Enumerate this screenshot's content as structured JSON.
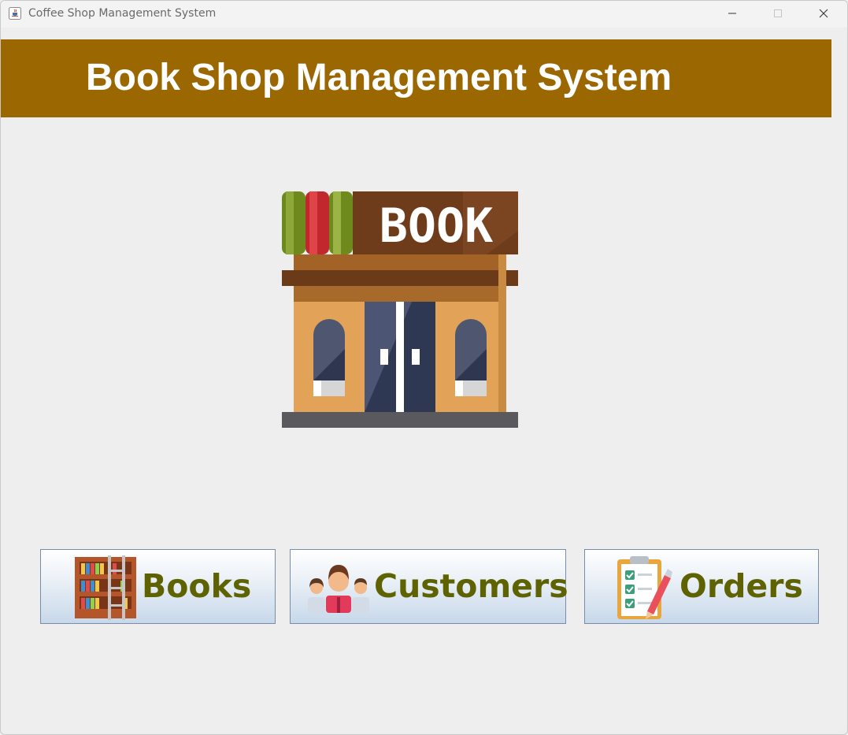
{
  "window": {
    "title": "Coffee Shop Management System",
    "controls": [
      "minimize-icon",
      "maximize-icon",
      "close-icon"
    ]
  },
  "header": {
    "title": "Book Shop Management System",
    "background": "#9a6700",
    "text_color": "#ffffff"
  },
  "hero": {
    "icon": "bookstore-icon",
    "sign_text": "BOOK"
  },
  "nav": {
    "books_label": "Books",
    "customers_label": "Customers",
    "orders_label": "Orders",
    "label_color": "#5f6200"
  }
}
